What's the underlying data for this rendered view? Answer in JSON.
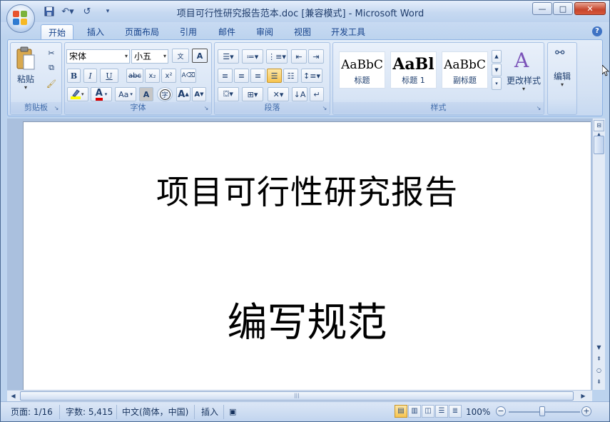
{
  "window": {
    "title": "项目可行性研究报告范本.doc [兼容模式] - Microsoft Word",
    "minimize_glyph": "—",
    "maximize_glyph": "□",
    "close_glyph": "✕"
  },
  "quick_access": {
    "save_icon": "save-icon",
    "undo_icon": "undo-icon",
    "redo_icon": "redo-icon"
  },
  "tabs": [
    {
      "label": "开始",
      "active": true
    },
    {
      "label": "插入"
    },
    {
      "label": "页面布局"
    },
    {
      "label": "引用"
    },
    {
      "label": "邮件"
    },
    {
      "label": "审阅"
    },
    {
      "label": "视图"
    },
    {
      "label": "开发工具"
    }
  ],
  "ribbon": {
    "clipboard": {
      "group_label": "剪贴板",
      "paste_label": "粘贴"
    },
    "font": {
      "group_label": "字体",
      "font_name": "宋体",
      "font_size": "小五",
      "bold": "B",
      "italic": "I",
      "underline": "U",
      "strike": "abc",
      "subscript": "x₂",
      "superscript": "x²",
      "font_color": "A",
      "change_case": "Aa",
      "grow": "A",
      "shrink": "A",
      "char_border": "A",
      "phonetic": "文",
      "enclose": "字",
      "highlight_color": "#ffff00",
      "font_color_value": "#e00000"
    },
    "paragraph": {
      "group_label": "段落"
    },
    "styles": {
      "group_label": "样式",
      "items": [
        {
          "sample": "AaBbC",
          "name": "标题"
        },
        {
          "sample": "AaBl",
          "name": "标题 1"
        },
        {
          "sample": "AaBbC",
          "name": "副标题"
        }
      ],
      "change_styles_label": "更改样式"
    },
    "editing": {
      "label": "编辑"
    }
  },
  "document": {
    "title": "项目可行性研究报告",
    "subtitle": "编写规范"
  },
  "statusbar": {
    "page": "页面: 1/16",
    "words": "字数: 5,415",
    "language": "中文(简体，中国)",
    "mode": "插入",
    "zoom": "100%"
  },
  "colors": {
    "accent": "#15428b",
    "ribbon_bg": "#d3e1f3",
    "frame": "#bcd3ee"
  }
}
